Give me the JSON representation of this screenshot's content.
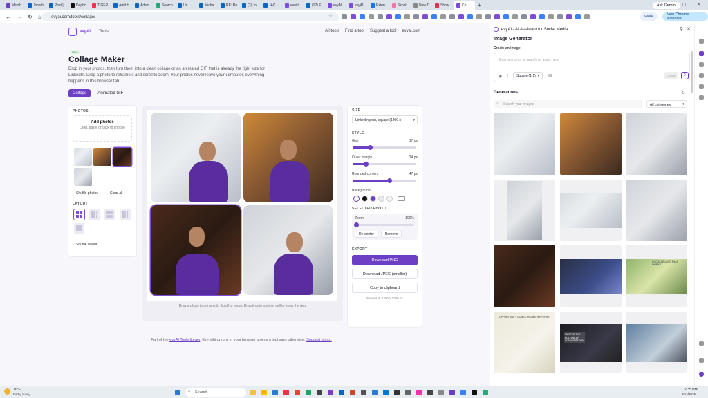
{
  "browser": {
    "tabs": [
      "Memb",
      "Jonath",
      "Post |",
      "Daphn",
      "TIGER",
      "Amit H",
      "Adam",
      "Search",
      "Un",
      "Micha",
      "RE: Re",
      "(3) Jo",
      "JAC -",
      "evei t",
      "(17) E",
      "evyAI",
      "evyAI",
      "Exten",
      "Skool",
      "New T",
      "Show",
      "Co"
    ],
    "active_tab": "Co",
    "ask_gemini": "Ask Gemini",
    "url": "evyai.com/tools/collage/",
    "profile": "Work",
    "update": "New Chrome available"
  },
  "site": {
    "brand": "evyAI",
    "nav_tools": "Tools",
    "links": [
      "All tools",
      "Find a tool",
      "Suggest a tool",
      "evyai.com"
    ]
  },
  "tool": {
    "badge": "NEW",
    "title": "Collage Maker",
    "intro": "Drop in your photos, then turn them into a clean collage or an animated GIF that is already the right size for LinkedIn. Drag a photo to reframe it and scroll to zoom. Your photos never leave your computer, everything happens in this browser tab.",
    "modes": [
      "Collage",
      "Animated GIF"
    ],
    "photos_label": "PHOTOS",
    "add_photos": "Add photos",
    "add_photos_sub": "Drop, paste or click to choose",
    "shuffle_photos": "Shuffle photos",
    "clear_all": "Clear all",
    "layout_label": "LAYOUT",
    "shuffle_layout": "Shuffle layout",
    "hint": "Drag a photo to reframe it. Scroll to zoom. Drag it onto another cell to swap the two.",
    "size_label": "SIZE",
    "size_value": "LinkedIn post, square (1200 x",
    "style_label": "STYLE",
    "gap_label": "Gap",
    "gap_value": "17 px",
    "gap_fraction": 0.27,
    "margin_label": "Outer margin",
    "margin_value": "24 px",
    "margin_fraction": 0.21,
    "radius_label": "Rounded corners",
    "radius_value": "47 px",
    "radius_fraction": 0.58,
    "background_label": "Background",
    "swatches": [
      "#ffffff",
      "#111111",
      "#6c3fc5",
      "#e9e9ee",
      "#f4f4f6"
    ],
    "selected_photo_label": "SELECTED PHOTO",
    "zoom_label": "Zoom",
    "zoom_value": "100%",
    "zoom_fraction": 0.0,
    "recenter": "Re-center",
    "remove": "Remove",
    "export_label": "EXPORT",
    "download_png": "Download PNG",
    "download_jpeg": "Download JPEG (smaller)",
    "copy": "Copy to clipboard",
    "exports_note": "Exports at 1200 x 1200 px",
    "footer_pre": "Part of the",
    "footer_link": "evyAI Tools library",
    "footer_mid": ". Everything runs in your browser unless a tool says otherwise.",
    "footer_suggest": "Suggest a tool."
  },
  "sidepanel": {
    "app_title": "evyAI - AI Assistant for Social Media",
    "heading": "Image Generator",
    "create_label": "Create an image",
    "prompt_placeholder": "Enter a prompt or search an asset here",
    "aspect": "Square (1:1)",
    "generate_btn": "Create",
    "generations_label": "Generations",
    "search_placeholder": "Search your images",
    "filter": "All categories",
    "overlay_text_1": "MASTER THE FOLLOW-UP CONVERSATION",
    "overlay_text_2": "SOCIALSELLING THAT WORKS",
    "overlay_text_3": "OPPORTUNITY COMES FROM EVERYTHING"
  },
  "taskbar": {
    "weather_temp": "70°F",
    "weather_desc": "Partly sunny",
    "search": "Search",
    "time": "2:35 PM",
    "date": "8/14/2026"
  }
}
